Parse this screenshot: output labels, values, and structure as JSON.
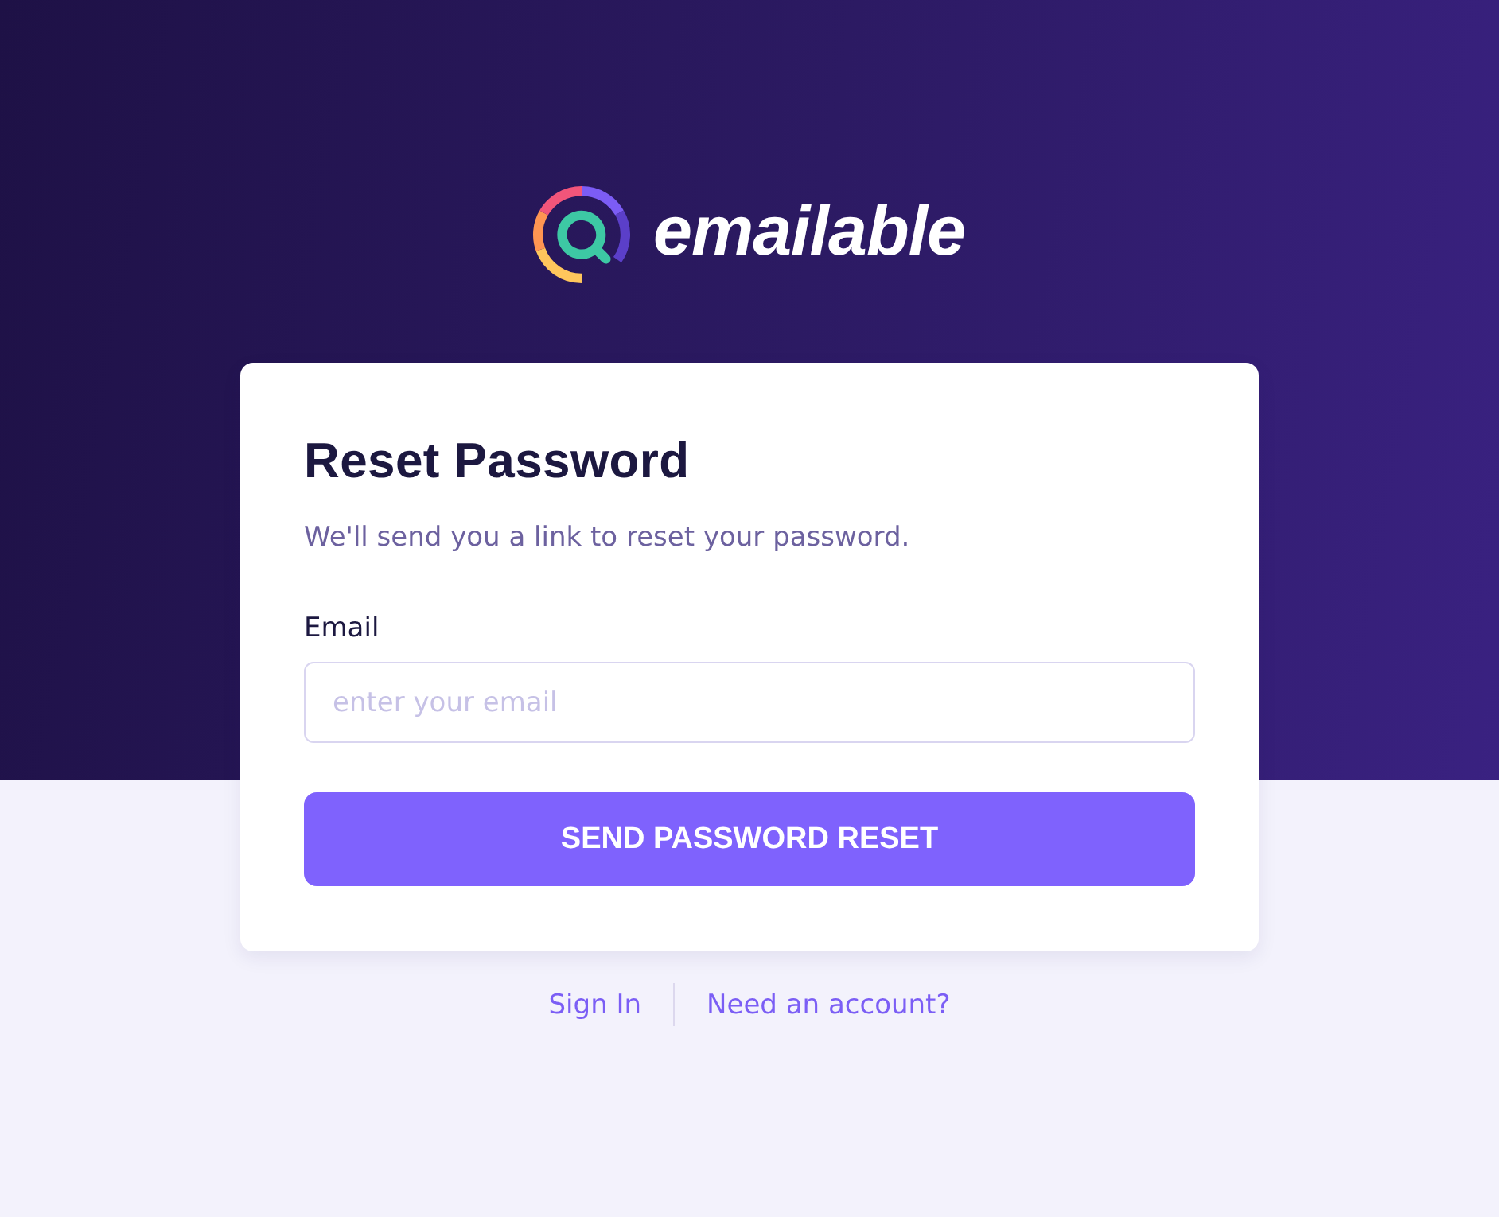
{
  "logo": {
    "wordmark": "emailable"
  },
  "card": {
    "title": "Reset Password",
    "subtitle": "We'll send you a link to reset your password.",
    "fields": [
      {
        "label": "Email",
        "placeholder": "enter your email"
      }
    ],
    "submit_button": "SEND PASSWORD RESET"
  },
  "footer_links": [
    "Sign In",
    "Need an account?"
  ]
}
